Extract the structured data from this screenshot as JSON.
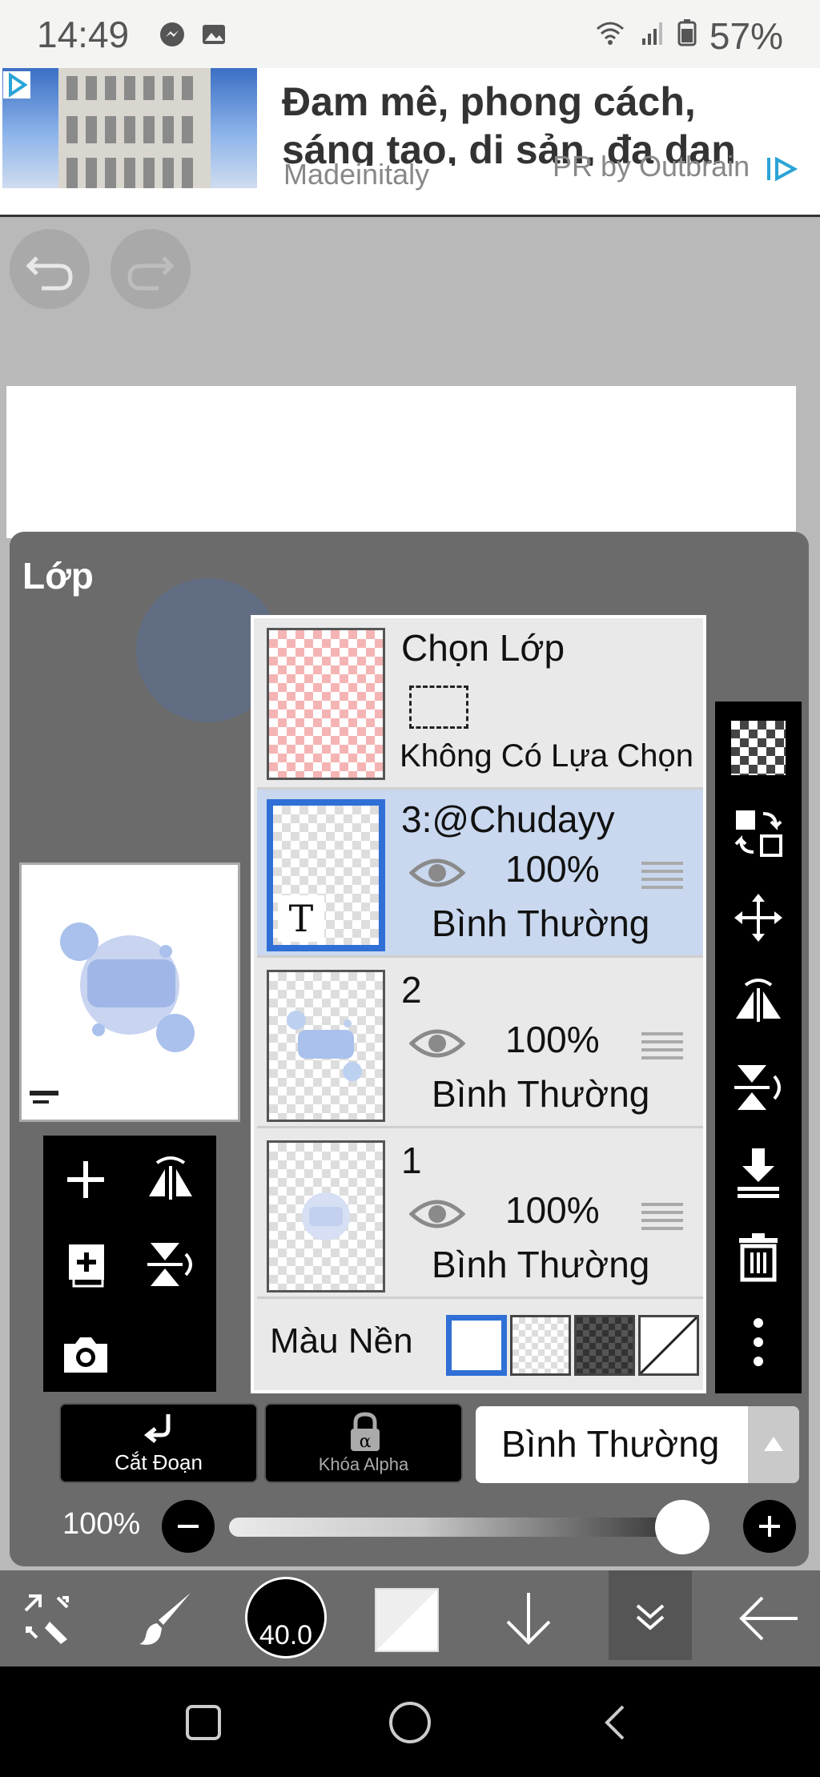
{
  "status_bar": {
    "time": "14:49",
    "battery": "57%",
    "icons": [
      "messenger-icon",
      "gallery-icon",
      "wifi-icon",
      "signal-icon",
      "battery-icon"
    ]
  },
  "ad": {
    "headline": "Đam mê, phong cách, sáng tạo, di sản, đa dạn",
    "source": "Madeinitaly",
    "pr_label": "PR by Outbrain"
  },
  "panel": {
    "title": "Lớp"
  },
  "selection_row": {
    "title": "Chọn Lớp",
    "status": "Không Có Lựa Chọn"
  },
  "layers": [
    {
      "name": "3:@Chudayy",
      "opacity": "100%",
      "mode": "Bình Thường",
      "type_badge": "T",
      "selected": true
    },
    {
      "name": "2",
      "opacity": "100%",
      "mode": "Bình Thường",
      "selected": false
    },
    {
      "name": "1",
      "opacity": "100%",
      "mode": "Bình Thường",
      "selected": false
    }
  ],
  "background": {
    "label": "Màu Nền"
  },
  "bottom_controls": {
    "clip_label": "Cắt Đoạn",
    "alpha_lock_label": "Khóa Alpha",
    "blend_mode": "Bình Thường",
    "opacity_label": "100%",
    "opacity_value": 1.0
  },
  "toolbar": {
    "brush_size": "40.0"
  },
  "colors": {
    "selected_blue": "#2f6fd6",
    "selected_row": "#c9d8ef",
    "panel_gray": "#6b6b6b"
  }
}
